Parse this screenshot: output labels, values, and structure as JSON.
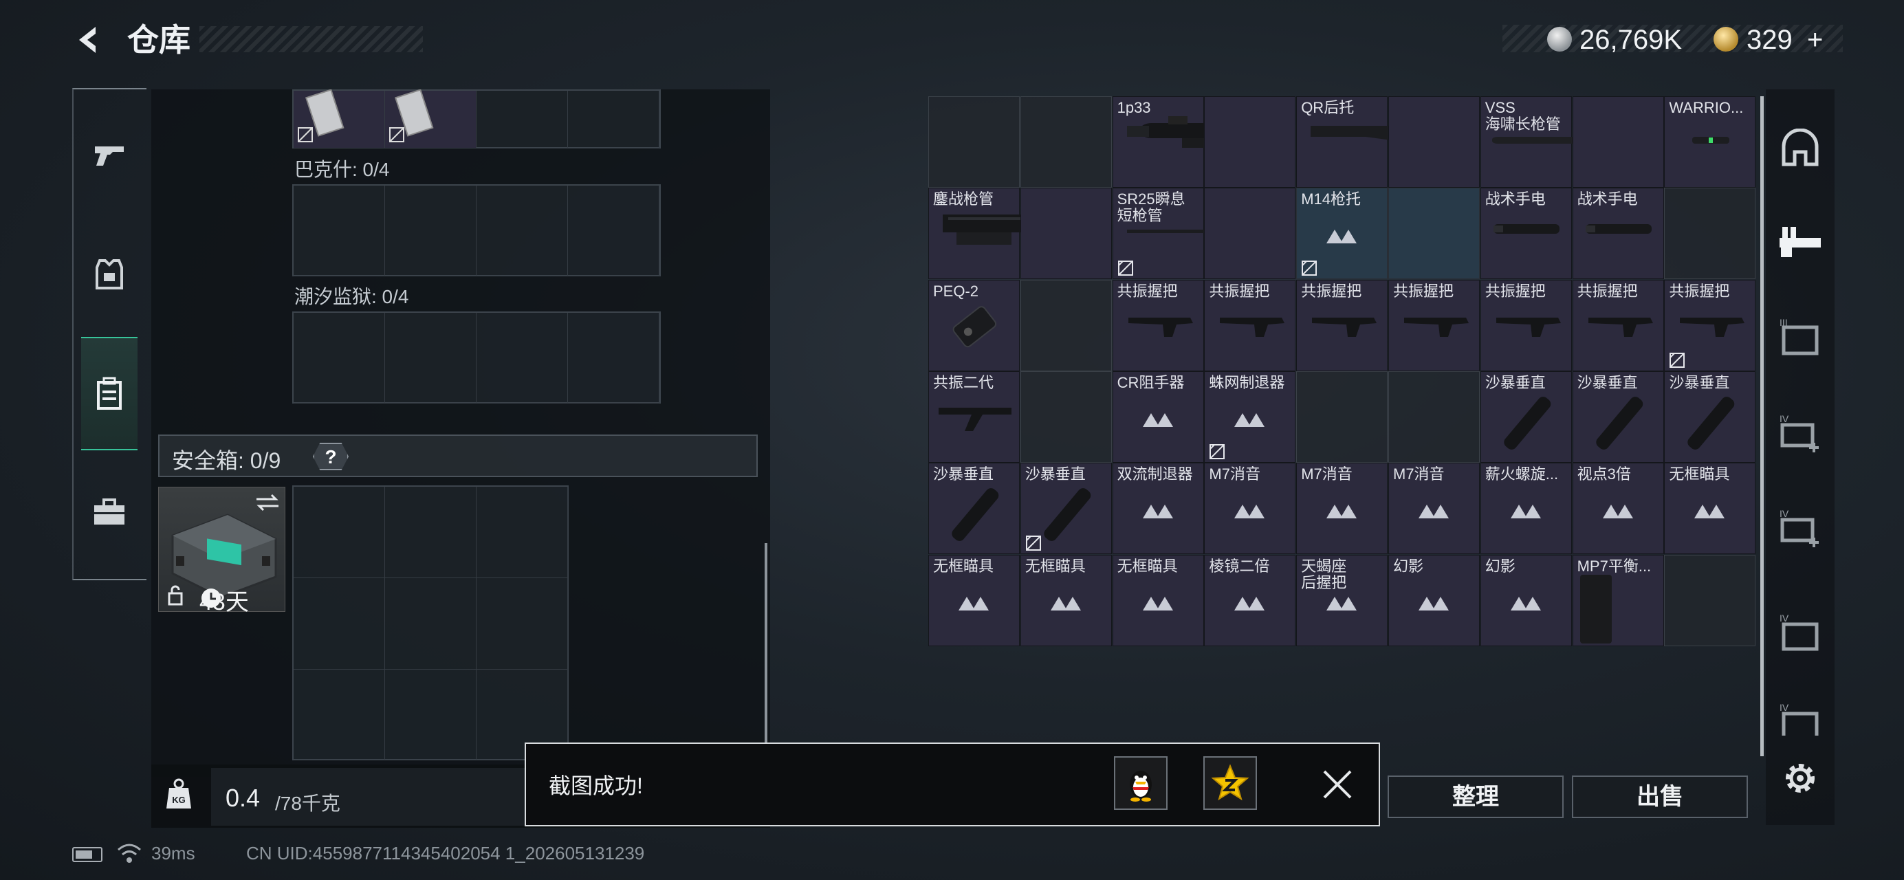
{
  "header": {
    "title": "仓库",
    "currency_amount": "26,769K",
    "gold_amount": "329",
    "gold_plus": "+"
  },
  "left_panel": {
    "sections": [
      {
        "label": "巴克什: 0/4"
      },
      {
        "label": "潮汐监狱: 0/4"
      }
    ],
    "safe_box": {
      "title": "安全箱: 0/9",
      "help": "?",
      "case_timer": "43天"
    },
    "weight": {
      "value": "0.4",
      "capacity": "/78千克"
    }
  },
  "status": {
    "ping": "39ms",
    "uid": "CN UID:4559877114345402054 1_202605131239"
  },
  "items": [
    {
      "label": "",
      "state": "empty"
    },
    {
      "label": "",
      "state": "empty"
    },
    {
      "label": "1p33",
      "state": "filled",
      "image": "scope"
    },
    {
      "label": "",
      "state": "filled"
    },
    {
      "label": "QR后托",
      "state": "filled",
      "image": "stock"
    },
    {
      "label": "",
      "state": "filled"
    },
    {
      "label": "VSS\n海啸长枪管",
      "state": "filled",
      "image": "barrel-long"
    },
    {
      "label": "",
      "state": "filled"
    },
    {
      "label": "WARRIO...",
      "state": "filled",
      "image": "flashlight-small"
    },
    {
      "label": "鏖战枪管",
      "state": "filled",
      "image": "handguard"
    },
    {
      "label": "",
      "state": "filled"
    },
    {
      "label": "SR25瞬息\n短枪管",
      "state": "filled",
      "image": "barrel-thin",
      "bound": true
    },
    {
      "label": "",
      "state": "filled"
    },
    {
      "label": "M14枪托",
      "state": "highlight",
      "image": "placeholder",
      "bound": true
    },
    {
      "label": "",
      "state": "highlight"
    },
    {
      "label": "战术手电",
      "state": "filled",
      "image": "flashlight"
    },
    {
      "label": "战术手电",
      "state": "filled",
      "image": "flashlight"
    },
    {
      "label": "",
      "state": "empty"
    },
    {
      "label": "PEQ-2",
      "state": "filled",
      "image": "peq"
    },
    {
      "label": "",
      "state": "empty"
    },
    {
      "label": "共振握把",
      "state": "filled",
      "image": "grip"
    },
    {
      "label": "共振握把",
      "state": "filled",
      "image": "grip"
    },
    {
      "label": "共振握把",
      "state": "filled",
      "image": "grip"
    },
    {
      "label": "共振握把",
      "state": "filled",
      "image": "grip"
    },
    {
      "label": "共振握把",
      "state": "filled",
      "image": "grip"
    },
    {
      "label": "共振握把",
      "state": "filled",
      "image": "grip"
    },
    {
      "label": "共振握把",
      "state": "filled",
      "image": "grip",
      "bound": true
    },
    {
      "label": "共振二代",
      "state": "filled",
      "image": "grip-angled"
    },
    {
      "label": "",
      "state": "empty"
    },
    {
      "label": "CR阻手器",
      "state": "filled",
      "image": "placeholder"
    },
    {
      "label": "蛛网制退器",
      "state": "filled",
      "image": "placeholder",
      "bound": true
    },
    {
      "label": "",
      "state": "empty"
    },
    {
      "label": "",
      "state": "empty"
    },
    {
      "label": "沙暴垂直",
      "state": "filled",
      "image": "vgrip"
    },
    {
      "label": "沙暴垂直",
      "state": "filled",
      "image": "vgrip"
    },
    {
      "label": "沙暴垂直",
      "state": "filled",
      "image": "vgrip"
    },
    {
      "label": "沙暴垂直",
      "state": "filled",
      "image": "vgrip"
    },
    {
      "label": "沙暴垂直",
      "state": "filled",
      "image": "vgrip",
      "bound": true
    },
    {
      "label": "双流制退器",
      "state": "filled",
      "image": "placeholder"
    },
    {
      "label": "M7消音",
      "state": "filled",
      "image": "placeholder"
    },
    {
      "label": "M7消音",
      "state": "filled",
      "image": "placeholder"
    },
    {
      "label": "M7消音",
      "state": "filled",
      "image": "placeholder"
    },
    {
      "label": "薪火螺旋...",
      "state": "filled",
      "image": "placeholder"
    },
    {
      "label": "视点3倍",
      "state": "filled",
      "image": "placeholder"
    },
    {
      "label": "无框瞄具",
      "state": "filled",
      "image": "placeholder"
    },
    {
      "label": "无框瞄具",
      "state": "filled",
      "image": "placeholder"
    },
    {
      "label": "无框瞄具",
      "state": "filled",
      "image": "placeholder"
    },
    {
      "label": "无框瞄具",
      "state": "filled",
      "image": "placeholder"
    },
    {
      "label": "棱镜二倍",
      "state": "filled",
      "image": "placeholder"
    },
    {
      "label": "天蝎座\n后握把",
      "state": "filled",
      "image": "placeholder"
    },
    {
      "label": "幻影",
      "state": "filled",
      "image": "placeholder"
    },
    {
      "label": "幻影",
      "state": "filled",
      "image": "placeholder"
    },
    {
      "label": "MP7平衡...",
      "state": "filled",
      "image": "mag"
    },
    {
      "label": "",
      "state": "empty"
    }
  ],
  "buttons": {
    "organize": "整理",
    "sell": "出售"
  },
  "toast": {
    "message": "截图成功!"
  },
  "colors": {
    "accent_green": "#37c49a",
    "item_bg": "#2c2a3d",
    "highlight_bg": "#283a49"
  }
}
